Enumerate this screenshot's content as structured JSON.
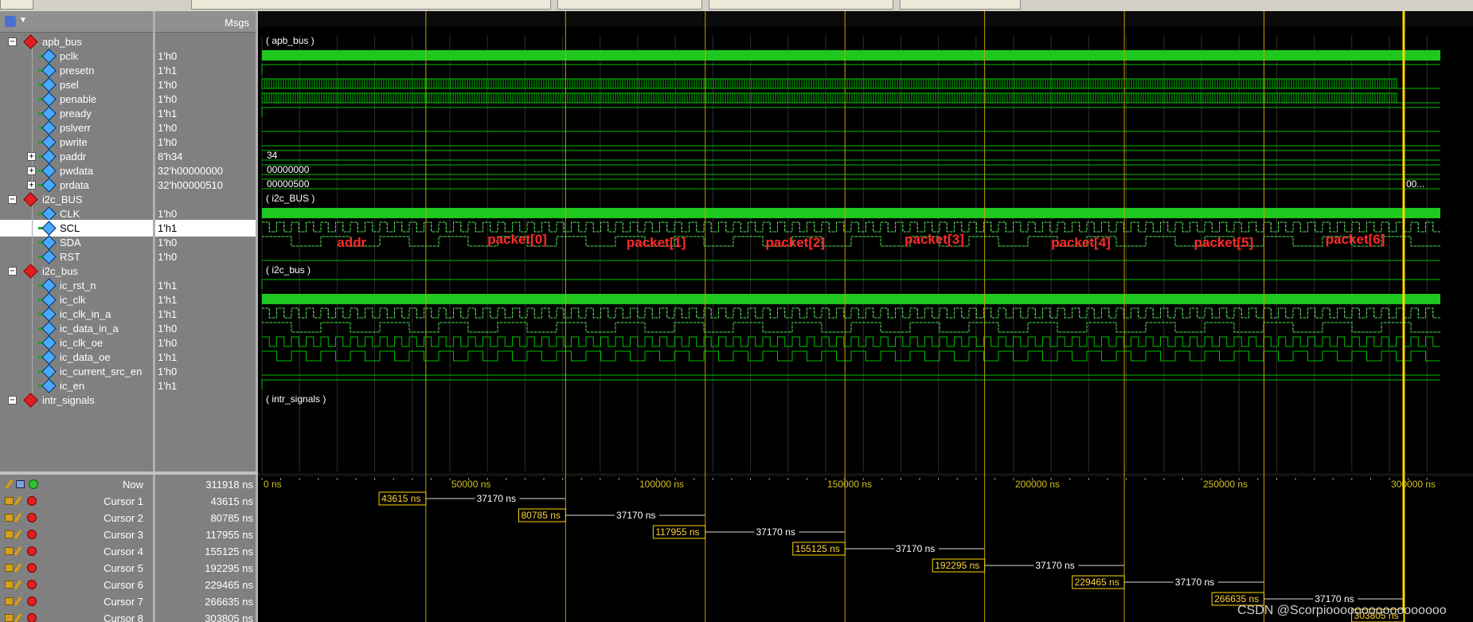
{
  "header": {
    "msgs_label": "Msgs"
  },
  "signals": [
    {
      "name": "apb_bus",
      "value": "",
      "kind": "group",
      "depth": 0
    },
    {
      "name": "pclk",
      "value": "1'h0",
      "kind": "clock",
      "depth": 1
    },
    {
      "name": "presetn",
      "value": "1'h1",
      "kind": "high",
      "depth": 1
    },
    {
      "name": "psel",
      "value": "1'h0",
      "kind": "dense",
      "depth": 1
    },
    {
      "name": "penable",
      "value": "1'h0",
      "kind": "dense",
      "depth": 1
    },
    {
      "name": "pready",
      "value": "1'h1",
      "kind": "high",
      "depth": 1
    },
    {
      "name": "pslverr",
      "value": "1'h0",
      "kind": "low",
      "depth": 1
    },
    {
      "name": "pwrite",
      "value": "1'h0",
      "kind": "low",
      "depth": 1
    },
    {
      "name": "paddr",
      "value": "8'h34",
      "kind": "bus",
      "bus_text": "34",
      "depth": 1
    },
    {
      "name": "pwdata",
      "value": "32'h00000000",
      "kind": "bus",
      "bus_text": "00000000",
      "depth": 1
    },
    {
      "name": "prdata",
      "value": "32'h00000510",
      "kind": "bus",
      "bus_text": "00000500",
      "bus_end_text": "00...",
      "depth": 1
    },
    {
      "name": "i2c_BUS",
      "value": "",
      "kind": "group",
      "depth": 0
    },
    {
      "name": "CLK",
      "value": "1'h0",
      "kind": "clock",
      "depth": 1
    },
    {
      "name": "SCL",
      "value": "1'h1",
      "kind": "scl",
      "depth": 1,
      "selected": true
    },
    {
      "name": "SDA",
      "value": "1'h0",
      "kind": "sda",
      "depth": 1
    },
    {
      "name": "RST",
      "value": "1'h0",
      "kind": "low",
      "depth": 1
    },
    {
      "name": "i2c_bus",
      "value": "",
      "kind": "group",
      "depth": 0
    },
    {
      "name": "ic_rst_n",
      "value": "1'h1",
      "kind": "high",
      "depth": 1
    },
    {
      "name": "ic_clk",
      "value": "1'h1",
      "kind": "clock",
      "depth": 1
    },
    {
      "name": "ic_clk_in_a",
      "value": "1'h1",
      "kind": "scl",
      "depth": 1
    },
    {
      "name": "ic_data_in_a",
      "value": "1'h0",
      "kind": "sda",
      "depth": 1
    },
    {
      "name": "ic_clk_oe",
      "value": "1'h0",
      "kind": "clkoe",
      "depth": 1
    },
    {
      "name": "ic_data_oe",
      "value": "1'h1",
      "kind": "dataoe",
      "depth": 1
    },
    {
      "name": "ic_current_src_en",
      "value": "1'h0",
      "kind": "low",
      "depth": 1
    },
    {
      "name": "ic_en",
      "value": "1'h1",
      "kind": "high",
      "depth": 1
    },
    {
      "name": "intr_signals",
      "value": "",
      "kind": "group",
      "depth": 0
    }
  ],
  "group_labels": [
    "( apb_bus )",
    "( i2c_BUS )",
    "( i2c_bus )",
    "( intr_signals )"
  ],
  "packet_labels": [
    "addr",
    "packet[0]",
    "packet[1]",
    "packet[2]",
    "packet[3]",
    "packet[4]",
    "packet[5]",
    "packet[6]"
  ],
  "timeline": {
    "now_label": "Now",
    "now_value": "311918 ns",
    "ticks": [
      "0 ns",
      "50000 ns",
      "100000 ns",
      "150000 ns",
      "200000 ns",
      "250000 ns",
      "300000 ns"
    ],
    "tick_values": [
      0,
      50000,
      100000,
      150000,
      200000,
      250000,
      300000
    ]
  },
  "cursors": [
    {
      "name": "Cursor 1",
      "value": "43615 ns",
      "time": 43615,
      "label": "43615 ns",
      "delta": "37170 ns"
    },
    {
      "name": "Cursor 2",
      "value": "80785 ns",
      "time": 80785,
      "label": "80785 ns",
      "delta": "37170 ns"
    },
    {
      "name": "Cursor 3",
      "value": "117955 ns",
      "time": 117955,
      "label": "117955 ns",
      "delta": "37170 ns"
    },
    {
      "name": "Cursor 4",
      "value": "155125 ns",
      "time": 155125,
      "label": "155125 ns",
      "delta": "37170 ns"
    },
    {
      "name": "Cursor 5",
      "value": "192295 ns",
      "time": 192295,
      "label": "192295 ns",
      "delta": "37170 ns"
    },
    {
      "name": "Cursor 6",
      "value": "229465 ns",
      "time": 229465,
      "label": "229465 ns",
      "delta": "37170 ns"
    },
    {
      "name": "Cursor 7",
      "value": "266635 ns",
      "time": 266635,
      "label": "266635 ns",
      "delta": "37170 ns"
    },
    {
      "name": "Cursor 8",
      "value": "303805 ns",
      "time": 303805,
      "label": "303805 ns",
      "delta": ""
    }
  ],
  "watermark": "CSDN @Scorpiooooooooooooooooo",
  "colors": {
    "wave_green": "#00c000",
    "wave_bright": "#1ec81e",
    "cursor_gold": "#c8a000",
    "active_cursor": "#ffd700",
    "packet_red": "#ff2a2a",
    "panel_gray": "#808080",
    "background": "#000000"
  }
}
